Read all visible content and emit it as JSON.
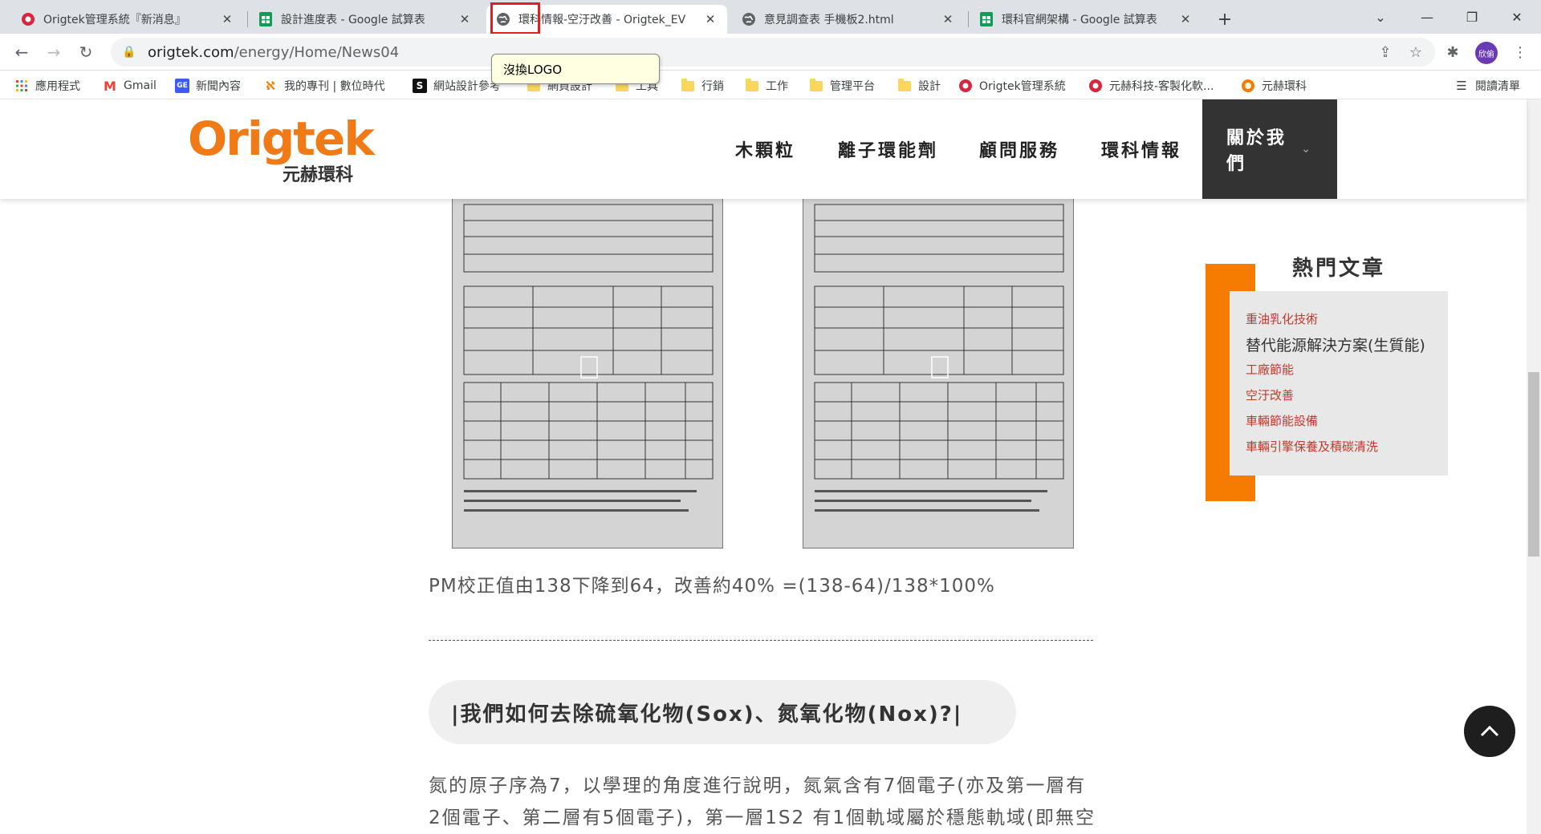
{
  "browser": {
    "tabs": [
      {
        "title": "Origtek管理系統『新消息』",
        "icon": "origtek-gear-icon"
      },
      {
        "title": "設計進度表 - Google 試算表",
        "icon": "google-sheets-icon"
      },
      {
        "title": "環科情報-空汙改善 - Origtek_EV",
        "icon": "globe-icon"
      },
      {
        "title": "意見調查表 手機板2.html",
        "icon": "globe-icon"
      },
      {
        "title": "環科官網架構 - Google 試算表",
        "icon": "google-sheets-icon"
      }
    ],
    "new_tab_label": "+",
    "url_host": "origtek.com",
    "url_path": "/energy/Home/News04",
    "avatar_text": "欣偷",
    "tooltip": "沒換LOGO",
    "bookmarks": [
      {
        "label": "應用程式",
        "icon": "apps-grid-icon"
      },
      {
        "label": "Gmail",
        "icon": "gmail-icon"
      },
      {
        "label": "新聞內容",
        "icon": "news-icon"
      },
      {
        "label": "我的專刊 | 數位時代",
        "icon": "bnext-icon"
      },
      {
        "label": "網站設計參考",
        "icon": "s-icon"
      },
      {
        "label": "網頁設計",
        "icon": "folder-icon"
      },
      {
        "label": "工具",
        "icon": "folder-icon"
      },
      {
        "label": "行銷",
        "icon": "folder-icon"
      },
      {
        "label": "工作",
        "icon": "folder-icon"
      },
      {
        "label": "管理平台",
        "icon": "folder-icon"
      },
      {
        "label": "設計",
        "icon": "folder-icon"
      },
      {
        "label": "Origtek管理系統",
        "icon": "origtek-gear-icon"
      },
      {
        "label": "元赫科技-客製化軟...",
        "icon": "origtek-gear-icon"
      },
      {
        "label": "元赫環科",
        "icon": "origtek-sun-icon"
      }
    ],
    "reading_list": "閱讀清單"
  },
  "site": {
    "logo_text": "Origtek",
    "logo_sub": "元赫環科",
    "nav": [
      "木顆粒",
      "離子環能劑",
      "顧問服務",
      "環科情報",
      "關於我們"
    ],
    "caption": "PM校正值由138下降到64，改善約40% =(138-64)/138*100%",
    "section_heading": "|我們如何去除硫氧化物(Sox)、氮氧化物(Nox)?|",
    "para_line1": "氮的原子序為7，以學理的角度進行說明，氮氣含有7個電子(亦及第一層有",
    "para_line2": "2個電子、第二層有5個電子)，第一層1S2 有1個軌域屬於穩態軌域(即無空",
    "sidebar": {
      "title": "熱門文章",
      "items": [
        "重油乳化技術",
        "替代能源解決方案(生質能)",
        "工廠節能",
        "空汙改善",
        "車輛節能設備",
        "車輛引擎保養及積碳清洗"
      ]
    }
  }
}
